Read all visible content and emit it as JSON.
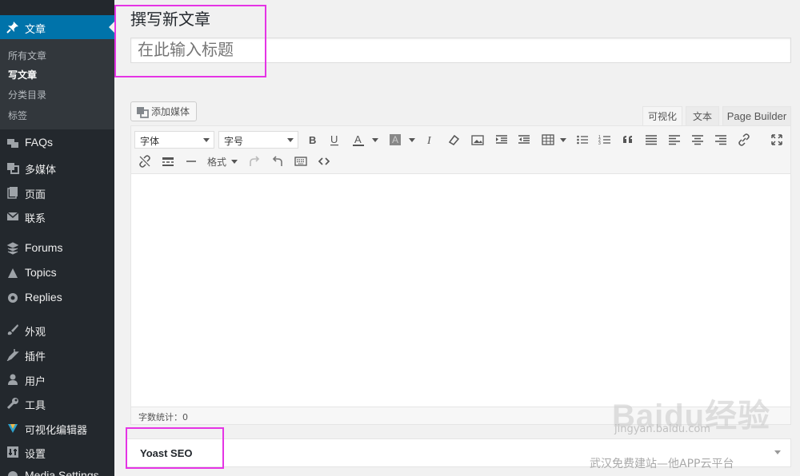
{
  "sidebar": {
    "active": {
      "label": "文章",
      "icon": "pin-icon"
    },
    "submenu": [
      "所有文章",
      "写文章",
      "分类目录",
      "标签"
    ],
    "submenu_current": "写文章",
    "items": [
      {
        "label": "FAQs",
        "icon": "faq-icon"
      },
      {
        "label": "多媒体",
        "icon": "media-icon"
      },
      {
        "label": "页面",
        "icon": "page-icon"
      },
      {
        "label": "联系",
        "icon": "mail-icon"
      },
      {
        "label": "Forums",
        "icon": "forums-icon"
      },
      {
        "label": "Topics",
        "icon": "topics-icon"
      },
      {
        "label": "Replies",
        "icon": "replies-icon"
      },
      {
        "label": "外观",
        "icon": "brush-icon"
      },
      {
        "label": "插件",
        "icon": "plugin-icon"
      },
      {
        "label": "用户",
        "icon": "user-icon"
      },
      {
        "label": "工具",
        "icon": "wrench-icon"
      },
      {
        "label": "可视化编辑器",
        "icon": "editor-icon"
      },
      {
        "label": "设置",
        "icon": "settings-icon"
      },
      {
        "label": "Media Settings",
        "icon": "media-settings-icon"
      }
    ]
  },
  "main": {
    "page_title": "撰写新文章",
    "title_placeholder": "在此输入标题",
    "add_media_label": "添加媒体",
    "tabs": [
      "可视化",
      "文本",
      "Page Builder"
    ],
    "active_tab": "可视化",
    "toolbar": {
      "font_family_label": "字体",
      "font_size_label": "字号",
      "format_label": "格式"
    },
    "word_count_label": "字数统计：0",
    "seo_box_title": "Yoast SEO"
  },
  "watermark": {
    "logo": "Baidu经验",
    "url": "jingyan.baidu.com",
    "caption": "武汉免费建站—他APP云平台"
  },
  "colors": {
    "sidebar_bg": "#23282d",
    "active_menu_bg": "#0073aa",
    "highlight_box": "#e534e5"
  }
}
